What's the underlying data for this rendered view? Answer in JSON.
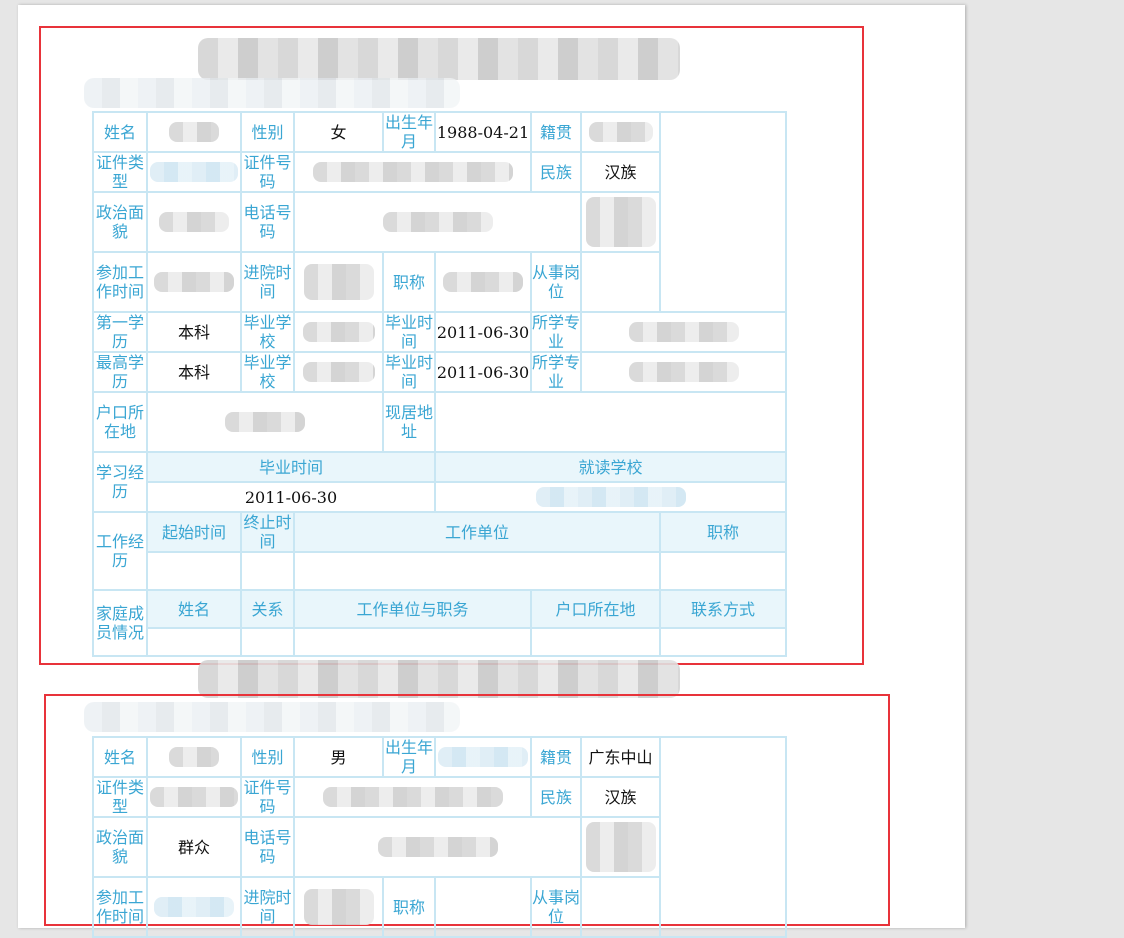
{
  "labels": {
    "name": "姓名",
    "gender": "性别",
    "birth": "出生年月",
    "native_place": "籍贯",
    "id_type": "证件类型",
    "id_number": "证件号码",
    "ethnicity": "民族",
    "political": "政治面貌",
    "phone": "电话号码",
    "work_start": "参加工作时间",
    "hospital_entry": "进院时间",
    "title": "职称",
    "post": "从事岗位",
    "first_edu": "第一学历",
    "grad_school": "毕业学校",
    "grad_time": "毕业时间",
    "major": "所学专业",
    "highest_edu": "最高学历",
    "hukou": "户口所在地",
    "residence": "现居地址",
    "study_history": "学习经历",
    "work_history": "工作经历",
    "family": "家庭成员情况"
  },
  "headers": {
    "grad_time": "毕业时间",
    "school": "就读学校",
    "start_time": "起始时间",
    "end_time": "终止时间",
    "employer": "工作单位",
    "job_title": "职称",
    "member_name": "姓名",
    "relation": "关系",
    "employer_position": "工作单位与职务",
    "member_hukou": "户口所在地",
    "contact": "联系方式"
  },
  "record1": {
    "gender": "女",
    "birth": "1988-04-21",
    "ethnicity": "汉族",
    "first_edu": "本科",
    "first_grad_time": "2011-06-30",
    "highest_edu": "本科",
    "highest_grad_time": "2011-06-30",
    "study_grad_time": "2011-06-30"
  },
  "record2": {
    "gender": "男",
    "native_place": "广东中山",
    "ethnicity": "汉族",
    "political": "群众"
  }
}
